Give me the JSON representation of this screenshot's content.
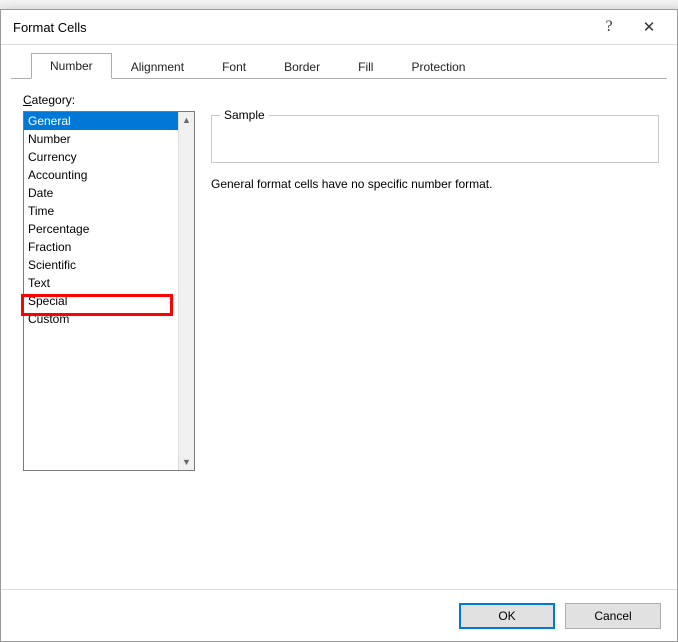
{
  "dialog": {
    "title": "Format Cells",
    "help_symbol": "?",
    "close_symbol": "✕"
  },
  "tabs": [
    {
      "label": "Number",
      "active": true
    },
    {
      "label": "Alignment",
      "active": false
    },
    {
      "label": "Font",
      "active": false
    },
    {
      "label": "Border",
      "active": false
    },
    {
      "label": "Fill",
      "active": false
    },
    {
      "label": "Protection",
      "active": false
    }
  ],
  "category": {
    "label_prefix": "C",
    "label_rest": "ategory:",
    "items": [
      "General",
      "Number",
      "Currency",
      "Accounting",
      "Date",
      "Time",
      "Percentage",
      "Fraction",
      "Scientific",
      "Text",
      "Special",
      "Custom"
    ],
    "selected_index": 0,
    "highlighted_index": 11
  },
  "sample": {
    "legend": "Sample",
    "value": ""
  },
  "description": "General format cells have no specific number format.",
  "buttons": {
    "ok": "OK",
    "cancel": "Cancel"
  },
  "scroll": {
    "up_glyph": "▲",
    "down_glyph": "▼"
  }
}
